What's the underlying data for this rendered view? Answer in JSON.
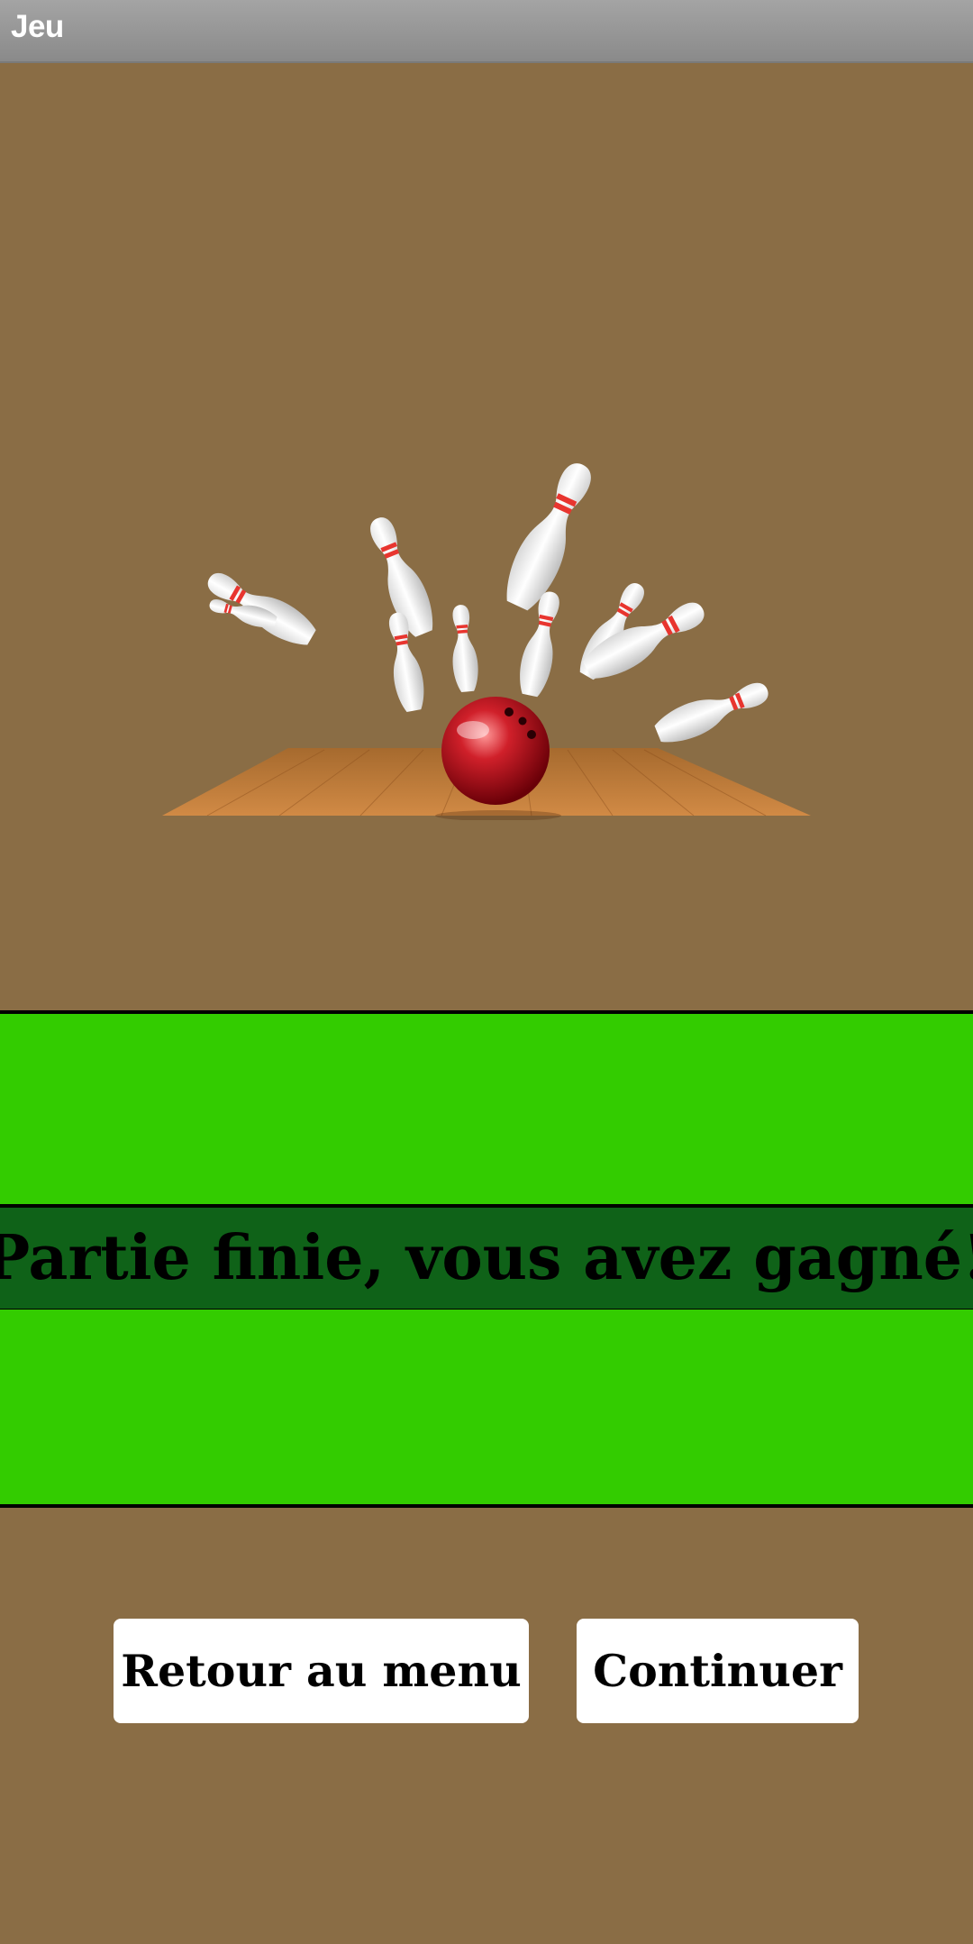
{
  "app": {
    "title": "Jeu"
  },
  "game": {
    "result_message": "Partie finie, vous avez gagné!"
  },
  "buttons": {
    "menu_label": "Retour au menu",
    "continue_label": "Continuer"
  },
  "colors": {
    "background": "#8a6d45",
    "band_green": "#33cc00",
    "banner_dark_green": "#0f6218",
    "button_bg": "#ffffff"
  }
}
